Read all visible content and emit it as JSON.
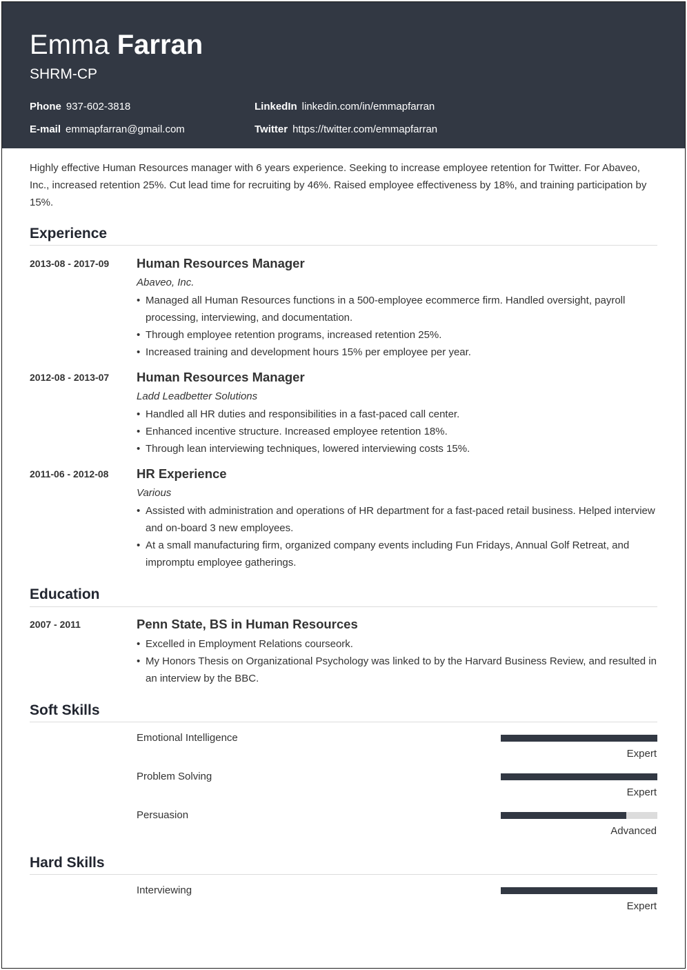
{
  "header": {
    "first_name": "Emma",
    "last_name": "Farran",
    "subtitle": "SHRM-CP",
    "contacts": {
      "phone": {
        "label": "Phone",
        "value": "937-602-3818"
      },
      "email": {
        "label": "E-mail",
        "value": "emmapfarran@gmail.com"
      },
      "linkedin": {
        "label": "LinkedIn",
        "value": "linkedin.com/in/emmapfarran"
      },
      "twitter": {
        "label": "Twitter",
        "value": "https://twitter.com/emmapfarran"
      }
    }
  },
  "summary": "Highly effective Human Resources manager with 6 years experience. Seeking to increase employee retention for Twitter. For Abaveo, Inc., increased retention 25%. Cut lead time for recruiting by 46%. Raised employee effectiveness by 18%, and training participation by 15%.",
  "experience": {
    "title": "Experience",
    "entries": [
      {
        "date": "2013-08 - 2017-09",
        "title": "Human Resources Manager",
        "org": "Abaveo, Inc.",
        "bullets": [
          "Managed all Human Resources functions in a 500-employee ecommerce firm. Handled oversight, payroll processing, interviewing, and documentation.",
          "Through employee retention programs, increased retention 25%.",
          "Increased training and development hours 15% per employee per year."
        ]
      },
      {
        "date": "2012-08 - 2013-07",
        "title": "Human Resources Manager",
        "org": "Ladd Leadbetter Solutions",
        "bullets": [
          "Handled all HR duties and responsibilities in a fast-paced call center.",
          "Enhanced incentive structure. Increased employee retention 18%.",
          "Through lean interviewing techniques, lowered interviewing costs 15%."
        ]
      },
      {
        "date": "2011-06 - 2012-08",
        "title": "HR Experience",
        "org": "Various",
        "bullets": [
          "Assisted with administration and operations of HR department for a fast-paced retail business. Helped interview and on-board 3 new employees.",
          "At a small manufacturing firm, organized company events including Fun Fridays, Annual Golf Retreat, and impromptu employee gatherings."
        ]
      }
    ]
  },
  "education": {
    "title": "Education",
    "entries": [
      {
        "date": "2007 - 2011",
        "title": "Penn State, BS in Human Resources",
        "bullets": [
          "Excelled in Employment Relations courseork.",
          "My Honors Thesis on Organizational Psychology was linked to by the Harvard Business Review, and resulted in an interview by the BBC."
        ]
      }
    ]
  },
  "soft_skills": {
    "title": "Soft Skills",
    "items": [
      {
        "name": "Emotional Intelligence",
        "level": "Expert",
        "fill_percent": 100
      },
      {
        "name": "Problem Solving",
        "level": "Expert",
        "fill_percent": 100
      },
      {
        "name": "Persuasion",
        "level": "Advanced",
        "fill_percent": 80
      }
    ]
  },
  "hard_skills": {
    "title": "Hard Skills",
    "items": [
      {
        "name": "Interviewing",
        "level": "Expert",
        "fill_percent": 100
      }
    ]
  },
  "colors": {
    "header_bg": "#323843",
    "bar_fill": "#323843",
    "bar_track": "#dcdcdc",
    "rule": "#dcdcdc"
  }
}
